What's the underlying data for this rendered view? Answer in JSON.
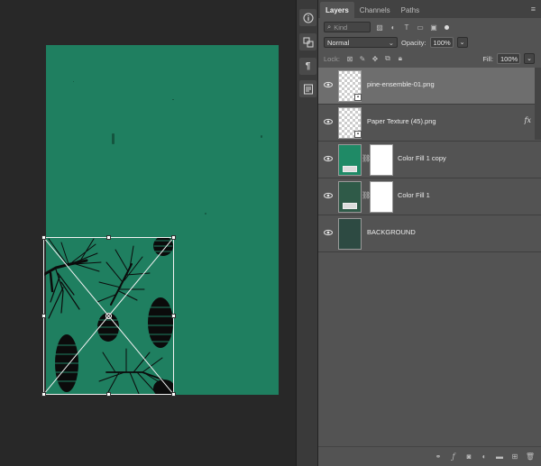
{
  "colors": {
    "document_green": "#1f7f60",
    "fill_copy_color": "#1f8a66",
    "fill_1_color": "#2f5a48",
    "background_layer_color": "#2d4a42"
  },
  "panel": {
    "tabs": [
      {
        "label": "Layers",
        "active": true
      },
      {
        "label": "Channels",
        "active": false
      },
      {
        "label": "Paths",
        "active": false
      }
    ],
    "filter": {
      "placeholder": "Kind"
    },
    "blend_mode": "Normal",
    "opacity_label": "Opacity:",
    "opacity_value": "100%",
    "lock_label": "Lock:",
    "fill_label": "Fill:",
    "fill_value": "100%"
  },
  "layers": [
    {
      "name": "pine-ensemble-01.png",
      "selected": true,
      "type": "smart-object",
      "visible": true
    },
    {
      "name": "Paper Texture (45).png",
      "selected": false,
      "type": "smart-object",
      "has_fx": true,
      "fx_label": "fx",
      "visible": true
    },
    {
      "name": "Color Fill 1 copy",
      "selected": false,
      "type": "fill",
      "visible": true
    },
    {
      "name": "Color Fill 1",
      "selected": false,
      "type": "fill",
      "visible": true
    },
    {
      "name": "BACKGROUND",
      "selected": false,
      "type": "pixel",
      "visible": true
    }
  ],
  "dock": {
    "buttons": [
      "info-icon",
      "properties-icon",
      "paragraph-icon",
      "notes-icon"
    ],
    "paragraph_glyph": "¶"
  }
}
